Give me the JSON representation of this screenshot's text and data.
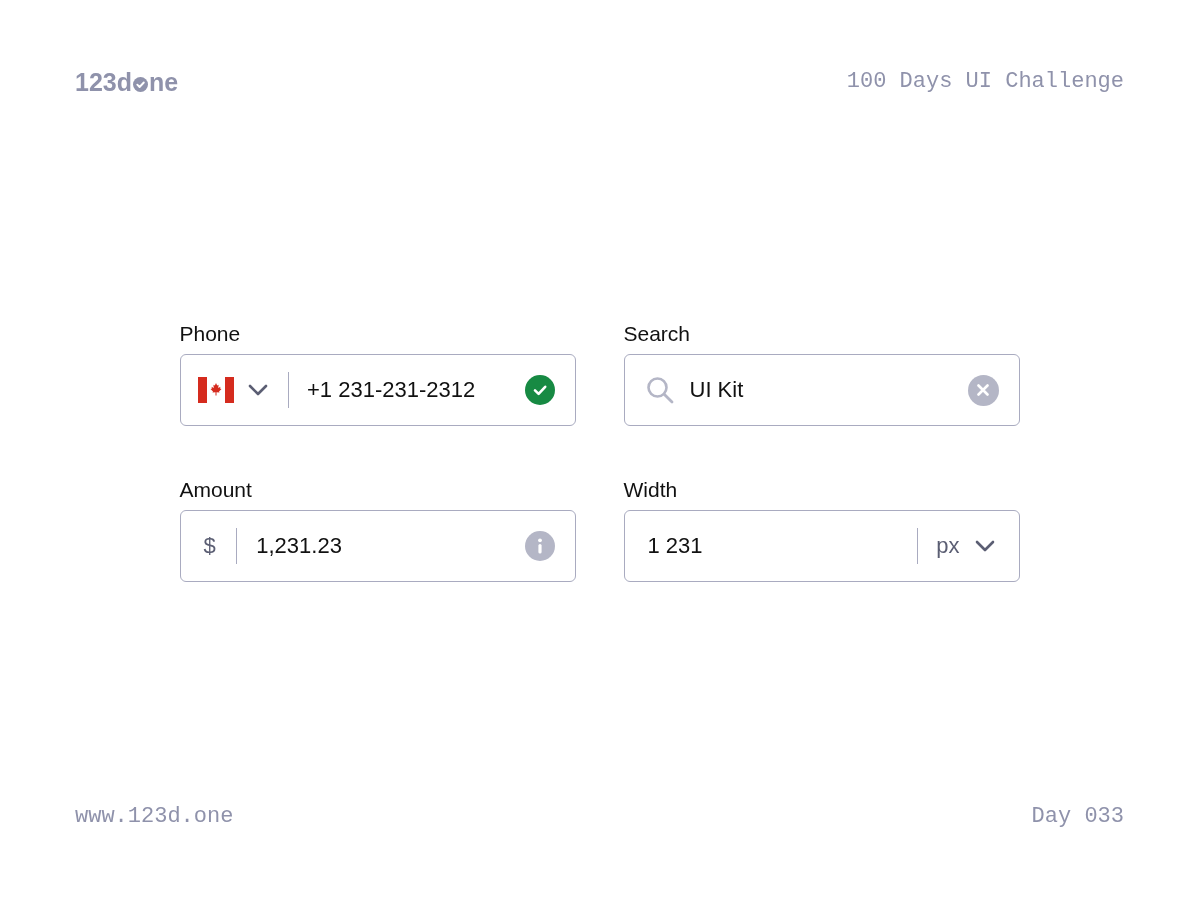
{
  "header": {
    "logo": {
      "lead": "123d",
      "tail": "ne"
    },
    "tagline": "100 Days UI Challenge"
  },
  "fields": [
    {
      "kind": "phone",
      "label": "Phone",
      "value": "+1 231-231-2312",
      "valid": true
    },
    {
      "kind": "search",
      "label": "Search",
      "value": "UI Kit"
    },
    {
      "kind": "amount",
      "label": "Amount",
      "prefix": "$",
      "value": "1,231.23"
    },
    {
      "kind": "unit",
      "label": "Width",
      "value": "1 231",
      "unit": "px"
    }
  ],
  "footer": {
    "website": "www.123d.one",
    "day": "Day 033"
  }
}
